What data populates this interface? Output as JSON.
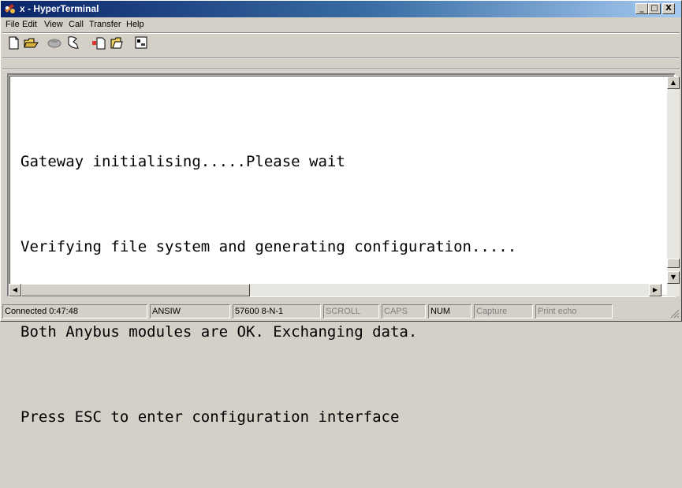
{
  "window": {
    "title": "x - HyperTerminal",
    "caption_buttons": [
      "_",
      "□",
      "X"
    ]
  },
  "menu": [
    "File",
    "Edit",
    "View",
    "Call",
    "Transfer",
    "Help"
  ],
  "toolbar": [
    "new-icon",
    "open-icon",
    "disconnect-icon",
    "phone-icon",
    "send-icon",
    "receive-icon",
    "properties-icon"
  ],
  "terminal": {
    "lines": [
      "Gateway initialising.....Please wait",
      "Verifying file system and generating configuration.....",
      "Both Anybus modules are OK. Exchanging data.",
      "Press ESC to enter configuration interface"
    ]
  },
  "status": {
    "connected": "Connected 0:47:48",
    "emulation": "ANSIW",
    "port_settings": "57600 8-N-1",
    "scroll": "SCROLL",
    "caps": "CAPS",
    "num": "NUM",
    "capture": "Capture",
    "print_echo": "Print echo"
  },
  "colors": {
    "titlebar_start": "#0a246a",
    "titlebar_end": "#a6caf0",
    "face": "#d4d0c8",
    "terminal_bg": "#ffffff"
  }
}
